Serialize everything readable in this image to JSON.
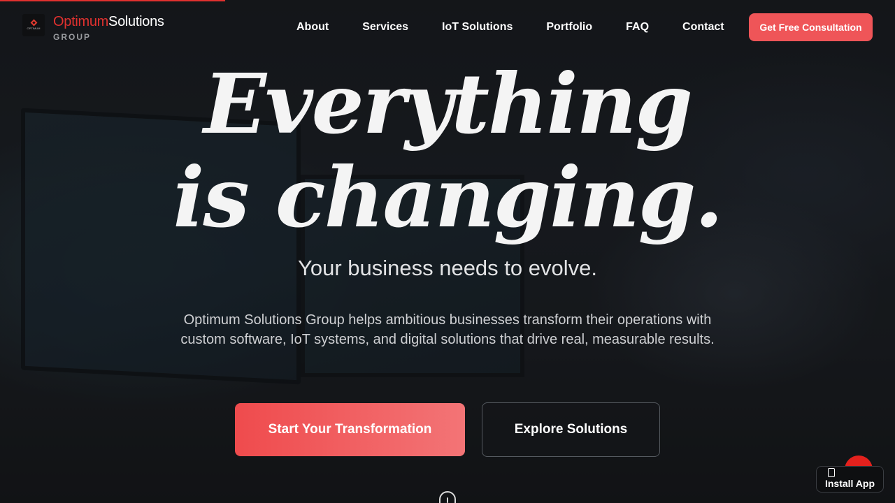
{
  "brand": {
    "name_accent": "Optimum",
    "name_rest": "Solutions",
    "sub": "GROUP",
    "logo_tiny": "OPTIMUM"
  },
  "nav": {
    "items": [
      {
        "label": "About"
      },
      {
        "label": "Services"
      },
      {
        "label": "IoT Solutions"
      },
      {
        "label": "Portfolio"
      },
      {
        "label": "FAQ"
      },
      {
        "label": "Contact"
      }
    ],
    "cta": "Get Free Consultation"
  },
  "hero": {
    "headline_line1": "Everything",
    "headline_line2": "is changing.",
    "subhead": "Your business needs to evolve.",
    "description": "Optimum Solutions Group helps ambitious businesses transform their operations with custom software, IoT systems, and digital solutions that drive real, measurable results.",
    "primary_button": "Start Your Transformation",
    "secondary_button": "Explore Solutions"
  },
  "install": {
    "label": "Install App",
    "icon": "phone-icon"
  },
  "colors": {
    "accent": "#e0312f",
    "button": "#ef5558",
    "background": "#15171b"
  }
}
